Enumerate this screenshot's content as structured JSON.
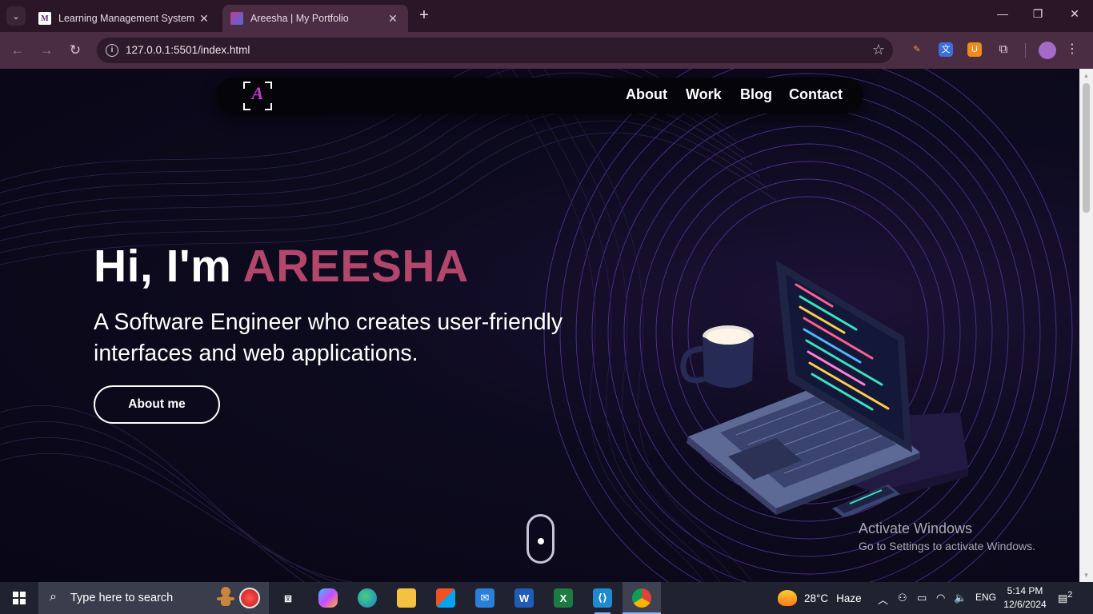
{
  "browser": {
    "tabs": [
      {
        "title": "Learning Management System",
        "active": false
      },
      {
        "title": "Areesha | My Portfolio",
        "active": true
      }
    ],
    "url": "127.0.0.1:5501/index.html"
  },
  "site": {
    "logo_letter": "A",
    "nav": [
      "About",
      "Work",
      "Blog",
      "Contact"
    ],
    "hero": {
      "greeting": "Hi, I'm ",
      "name": "AREESHA",
      "subtitle": "A Software Engineer who creates user-friendly interfaces and web applications.",
      "button": "About me"
    },
    "accent_color": "#b2466b"
  },
  "watermark": {
    "line1": "Activate Windows",
    "line2": "Go to Settings to activate Windows."
  },
  "taskbar": {
    "search_placeholder": "Type here to search",
    "weather": {
      "temp": "28°C",
      "condition": "Haze"
    },
    "language": "ENG",
    "time": "5:14 PM",
    "date": "12/6/2024",
    "notifications": "2"
  }
}
